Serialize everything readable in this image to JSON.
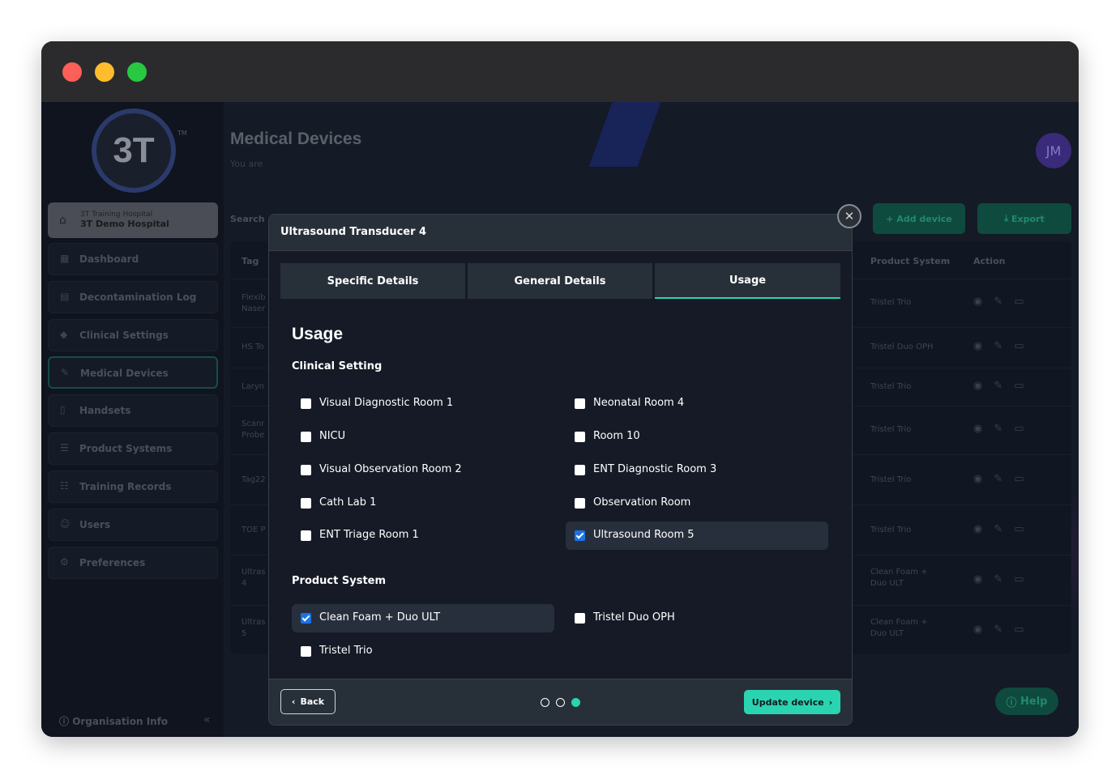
{
  "sidebar": {
    "logo_text": "3T",
    "hospital": {
      "small": "3T Training Hospital",
      "name": "3T Demo Hospital"
    },
    "items": [
      {
        "label": "Dashboard",
        "icon": "grid-icon"
      },
      {
        "label": "Decontamination Log",
        "icon": "document-icon"
      },
      {
        "label": "Clinical Settings",
        "icon": "diamond-icon"
      },
      {
        "label": "Medical Devices",
        "icon": "pencil-icon"
      },
      {
        "label": "Handsets",
        "icon": "phone-icon"
      },
      {
        "label": "Product Systems",
        "icon": "list-icon"
      },
      {
        "label": "Training Records",
        "icon": "list-icon"
      },
      {
        "label": "Users",
        "icon": "users-icon"
      },
      {
        "label": "Preferences",
        "icon": "gear-icon"
      }
    ],
    "org_info": "Organisation Info"
  },
  "header": {
    "title": "Medical Devices",
    "subtitle": "You are",
    "search_label": "Search",
    "avatar": "JM",
    "add_device": "Add device",
    "export": "Export"
  },
  "table": {
    "headers": {
      "tag": "Tag",
      "product_system": "Product System",
      "action": "Action"
    },
    "rows": [
      {
        "tag": "Flexib\nNaser",
        "product_system": "Tristel Trio"
      },
      {
        "tag": "HS To",
        "product_system": "Tristel Duo OPH"
      },
      {
        "tag": "Laryn",
        "product_system": "Tristel Trio"
      },
      {
        "tag": "Scanr\nProbe",
        "product_system": "Tristel Trio"
      },
      {
        "tag": "Tag22",
        "product_system": "Tristel Trio"
      },
      {
        "tag": "TOE P",
        "product_system": "Tristel Trio"
      },
      {
        "tag": "Ultras\n4",
        "product_system": "Clean Foam +\nDuo ULT"
      },
      {
        "tag": "Ultras\n5",
        "product_system": "Clean Foam +\nDuo ULT"
      }
    ]
  },
  "help": "Help",
  "modal": {
    "title": "Ultrasound Transducer 4",
    "tabs": [
      "Specific Details",
      "General Details",
      "Usage"
    ],
    "active_tab": "Usage",
    "heading": "Usage",
    "clinical_setting": {
      "label": "Clinical Setting",
      "options": [
        {
          "label": "Visual Diagnostic Room 1",
          "checked": false
        },
        {
          "label": "Neonatal Room 4",
          "checked": false
        },
        {
          "label": "NICU",
          "checked": false
        },
        {
          "label": "Room 10",
          "checked": false
        },
        {
          "label": "Visual Observation Room 2",
          "checked": false
        },
        {
          "label": "ENT Diagnostic Room 3",
          "checked": false
        },
        {
          "label": "Cath Lab 1",
          "checked": false
        },
        {
          "label": "Observation Room",
          "checked": false
        },
        {
          "label": "ENT Triage Room 1",
          "checked": false
        },
        {
          "label": "Ultrasound Room 5",
          "checked": true
        }
      ]
    },
    "product_system": {
      "label": "Product System",
      "options": [
        {
          "label": "Clean Foam + Duo ULT",
          "checked": true
        },
        {
          "label": "Tristel Duo OPH",
          "checked": false
        },
        {
          "label": "Tristel Trio",
          "checked": false
        }
      ]
    },
    "back_label": "Back",
    "update_label": "Update device",
    "step": {
      "current": 3,
      "total": 3
    }
  },
  "colors": {
    "accent": "#2bd4b0",
    "checkbox": "#1a73e8",
    "modal_bg": "#151a26"
  }
}
